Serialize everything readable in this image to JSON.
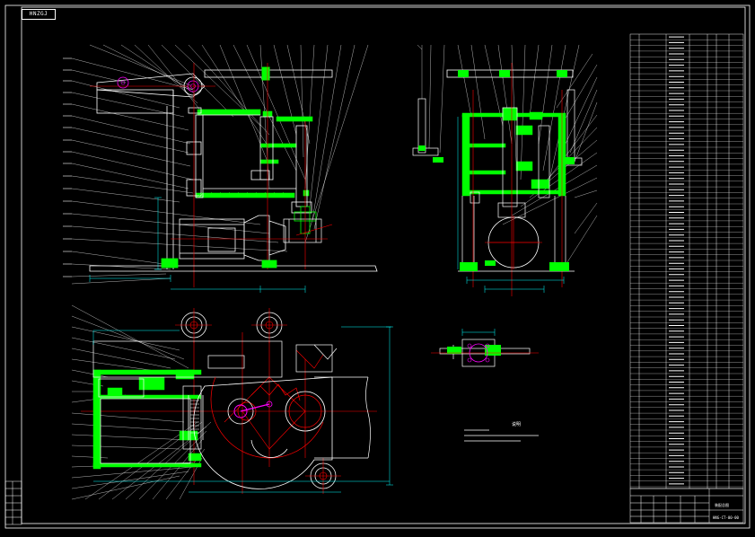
{
  "sheet": {
    "title_tag": "HNZGJ",
    "tech_notes_title": "说明",
    "title_block_name": "装配总图",
    "drawing_number": "HNG-CT-00-00"
  },
  "colors": {
    "background": "#000000",
    "outline": "#ffffff",
    "part": "#00ff00",
    "centerline": "#ff0000",
    "dimension": "#00ffff",
    "motor": "#ffffff",
    "pinion": "#ff00ff"
  },
  "views": [
    {
      "name": "front-view"
    },
    {
      "name": "side-view"
    },
    {
      "name": "top-view"
    },
    {
      "name": "detail-view"
    }
  ]
}
